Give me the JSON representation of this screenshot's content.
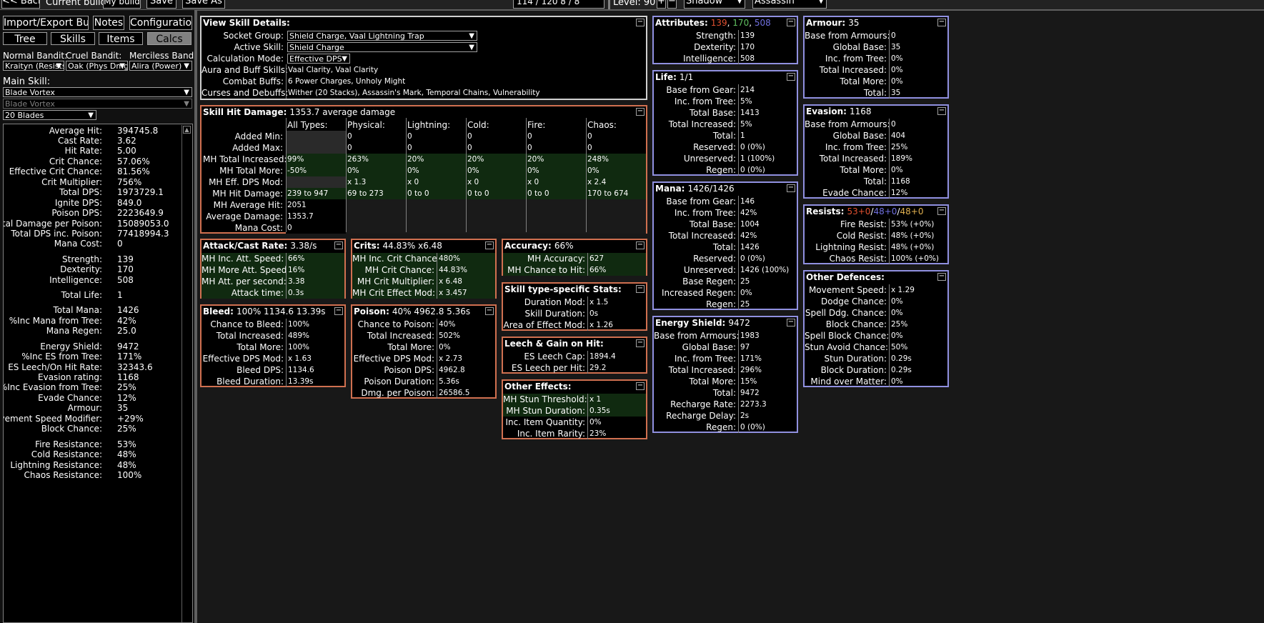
{
  "topbar": {
    "back": "<< Back",
    "current_build_label": "Current build:",
    "build_name": "My build",
    "save": "Save",
    "save_as": "Save As",
    "points": "114 / 120    8 / 8",
    "level": "Level: 90",
    "plus": "+",
    "minus": "−",
    "class": "Shadow",
    "ascendancy": "Assassin"
  },
  "sidebar": {
    "import_export": "Import/Export Build",
    "notes": "Notes",
    "configuration": "Configuration",
    "tabs": [
      "Tree",
      "Skills",
      "Items",
      "Calcs"
    ],
    "normal_bandit_label": "Normal Bandit:",
    "cruel_bandit_label": "Cruel Bandit:",
    "merciless_bandit_label": "Merciless Bandit:",
    "normal_bandit": "Kraityn (Resists)",
    "cruel_bandit": "Oak (Phys Dmg)",
    "merciless_bandit": "Alira (Power)",
    "main_skill_label": "Main Skill:",
    "main_skill": "Blade Vortex",
    "sub_skill": "Blade Vortex",
    "stage": "20 Blades",
    "stats": [
      {
        "k": "Average Hit:",
        "v": "394745.8"
      },
      {
        "k": "Cast Rate:",
        "v": "3.62"
      },
      {
        "k": "Hit Rate:",
        "v": "5.00"
      },
      {
        "k": "Crit Chance:",
        "v": "57.06%"
      },
      {
        "k": "Effective Crit Chance:",
        "v": "81.56%"
      },
      {
        "k": "Crit Multiplier:",
        "v": "756%"
      },
      {
        "k": "Total DPS:",
        "v": "1973729.1"
      },
      {
        "k": "Ignite DPS:",
        "v": "849.0"
      },
      {
        "k": "Poison DPS:",
        "v": "2223649.9"
      },
      {
        "k": "Total Damage per Poison:",
        "v": "15089053.0"
      },
      {
        "k": "Total DPS inc. Poison:",
        "v": "77418994.3"
      },
      {
        "k": "Mana Cost:",
        "v": "0"
      },
      {
        "k": "Strength:",
        "v": "139"
      },
      {
        "k": "Dexterity:",
        "v": "170"
      },
      {
        "k": "Intelligence:",
        "v": "508"
      },
      {
        "k": "Total Life:",
        "v": "1"
      },
      {
        "k": "Total Mana:",
        "v": "1426"
      },
      {
        "k": "%Inc Mana from Tree:",
        "v": "42%"
      },
      {
        "k": "Mana Regen:",
        "v": "25.0"
      },
      {
        "k": "Energy Shield:",
        "v": "9472"
      },
      {
        "k": "%Inc ES from Tree:",
        "v": "171%"
      },
      {
        "k": "ES Leech/On Hit Rate:",
        "v": "32343.6"
      },
      {
        "k": "Evasion rating:",
        "v": "1168"
      },
      {
        "k": "%Inc Evasion from Tree:",
        "v": "25%"
      },
      {
        "k": "Evade Chance:",
        "v": "12%"
      },
      {
        "k": "Armour:",
        "v": "35"
      },
      {
        "k": "Movement Speed Modifier:",
        "v": "+29%"
      },
      {
        "k": "Block Chance:",
        "v": "25%"
      },
      {
        "k": "Fire Resistance:",
        "v": "53%"
      },
      {
        "k": "Cold Resistance:",
        "v": "48%"
      },
      {
        "k": "Lightning Resistance:",
        "v": "48%"
      },
      {
        "k": "Chaos Resistance:",
        "v": "100%"
      }
    ]
  },
  "view_skill": {
    "title": "View Skill Details:",
    "socket_group_label": "Socket Group:",
    "socket_group": "Shield Charge, Vaal Lightning Trap",
    "active_skill_label": "Active Skill:",
    "active_skill": "Shield Charge",
    "calc_mode_label": "Calculation Mode:",
    "calc_mode": "Effective DPS",
    "aura_label": "Aura and Buff Skills:",
    "aura": "Vaal Clarity, Vaal Clarity",
    "combat_label": "Combat Buffs:",
    "combat": "6 Power Charges, Unholy Might",
    "curses_label": "Curses and Debuffs:",
    "curses": "Wither (20 Stacks), Assassin's Mark, Temporal Chains, Vulnerability"
  },
  "hit_damage": {
    "title": "Skill Hit Damage:",
    "value": "1353.7 average damage",
    "columns": [
      "All Types:",
      "Physical:",
      "Lightning:",
      "Cold:",
      "Fire:",
      "Chaos:"
    ],
    "rows": [
      {
        "k": "Added Min:",
        "cells": [
          "",
          "0",
          "0",
          "0",
          "0",
          "0"
        ]
      },
      {
        "k": "Added Max:",
        "cells": [
          "",
          "0",
          "0",
          "0",
          "0",
          "0"
        ]
      },
      {
        "k": "MH Total Increased:",
        "cells": [
          "99%",
          "263%",
          "20%",
          "20%",
          "20%",
          "248%"
        ]
      },
      {
        "k": "MH Total More:",
        "cells": [
          "-50%",
          "0%",
          "0%",
          "0%",
          "0%",
          "0%"
        ]
      },
      {
        "k": "MH Eff. DPS Mod:",
        "cells": [
          "",
          "x 1.3",
          "x 0",
          "x 0",
          "x 0",
          "x 2.4"
        ]
      },
      {
        "k": "MH Hit Damage:",
        "cells": [
          "239 to 947",
          "69 to 273",
          "0 to 0",
          "0 to 0",
          "0 to 0",
          "170 to 674"
        ]
      },
      {
        "k": "MH Average Hit:",
        "cells": [
          "2051"
        ]
      },
      {
        "k": "Average Damage:",
        "cells": [
          "1353.7"
        ]
      },
      {
        "k": "Mana Cost:",
        "cells": [
          "0"
        ]
      }
    ]
  },
  "attack_rate": {
    "title": "Attack/Cast Rate:",
    "value": "3.38/s",
    "rows": [
      {
        "k": "MH Inc. Att. Speed:",
        "v": "66%"
      },
      {
        "k": "MH More Att. Speed:",
        "v": "16%"
      },
      {
        "k": "MH Att. per second:",
        "v": "3.38"
      },
      {
        "k": "Attack time:",
        "v": "0.3s"
      }
    ]
  },
  "crits": {
    "title": "Crits:",
    "value": "44.83% x6.48",
    "rows": [
      {
        "k": "MH Inc. Crit Chance:",
        "v": "480%"
      },
      {
        "k": "MH Crit Chance:",
        "v": "44.83%"
      },
      {
        "k": "MH Crit Multiplier:",
        "v": "x 6.48"
      },
      {
        "k": "MH Crit Effect Mod:",
        "v": "x 3.457"
      }
    ]
  },
  "accuracy": {
    "title": "Accuracy:",
    "value": "66%",
    "rows": [
      {
        "k": "MH Accuracy:",
        "v": "627"
      },
      {
        "k": "MH Chance to Hit:",
        "v": "66%"
      }
    ]
  },
  "skill_type": {
    "title": "Skill type-specific Stats:",
    "rows": [
      {
        "k": "Duration Mod:",
        "v": "x 1.5"
      },
      {
        "k": "Skill Duration:",
        "v": "0s"
      },
      {
        "k": "Area of Effect Mod:",
        "v": "x 1.26"
      }
    ]
  },
  "leech": {
    "title": "Leech & Gain on Hit:",
    "rows": [
      {
        "k": "ES Leech Cap:",
        "v": "1894.4"
      },
      {
        "k": "ES Leech per Hit:",
        "v": "29.2"
      }
    ]
  },
  "other_effects": {
    "title": "Other Effects:",
    "rows": [
      {
        "k": "MH Stun Threshold:",
        "v": "x 1"
      },
      {
        "k": "MH Stun Duration:",
        "v": "0.35s"
      },
      {
        "k": "Inc. Item Quantity:",
        "v": "0%"
      },
      {
        "k": "Inc. Item Rarity:",
        "v": "23%"
      }
    ]
  },
  "bleed": {
    "title": "Bleed:",
    "value": "100% 1134.6 13.39s",
    "rows": [
      {
        "k": "Chance to Bleed:",
        "v": "100%"
      },
      {
        "k": "Total Increased:",
        "v": "489%"
      },
      {
        "k": "Total More:",
        "v": "100%"
      },
      {
        "k": "Effective DPS Mod:",
        "v": "x 1.63"
      },
      {
        "k": "Bleed DPS:",
        "v": "1134.6"
      },
      {
        "k": "Bleed Duration:",
        "v": "13.39s"
      }
    ]
  },
  "poison": {
    "title": "Poison:",
    "value": "40% 4962.8 5.36s",
    "rows": [
      {
        "k": "Chance to Poison:",
        "v": "40%"
      },
      {
        "k": "Total Increased:",
        "v": "502%"
      },
      {
        "k": "Total More:",
        "v": "0%"
      },
      {
        "k": "Effective DPS Mod:",
        "v": "x 2.73"
      },
      {
        "k": "Poison DPS:",
        "v": "4962.8"
      },
      {
        "k": "Poison Duration:",
        "v": "5.36s"
      },
      {
        "k": "Dmg. per Poison:",
        "v": "26586.5"
      }
    ]
  },
  "attributes": {
    "title": "Attributes:",
    "str": "139",
    "sep1": ", ",
    "dex": "170",
    "sep2": ", ",
    "int": "508",
    "rows": [
      {
        "k": "Strength:",
        "v": "139"
      },
      {
        "k": "Dexterity:",
        "v": "170"
      },
      {
        "k": "Intelligence:",
        "v": "508"
      }
    ]
  },
  "life": {
    "title": "Life:",
    "value": "1/1",
    "rows": [
      {
        "k": "Base from Gear:",
        "v": "214"
      },
      {
        "k": "Inc. from Tree:",
        "v": "5%"
      },
      {
        "k": "Total Base:",
        "v": "1413"
      },
      {
        "k": "Total Increased:",
        "v": "5%"
      },
      {
        "k": "Total:",
        "v": "1"
      },
      {
        "k": "Reserved:",
        "v": "0 (0%)"
      },
      {
        "k": "Unreserved:",
        "v": "1 (100%)"
      },
      {
        "k": "Regen:",
        "v": "0 (0%)"
      }
    ]
  },
  "mana": {
    "title": "Mana:",
    "value": "1426/1426",
    "rows": [
      {
        "k": "Base from Gear:",
        "v": "146"
      },
      {
        "k": "Inc. from Tree:",
        "v": "42%"
      },
      {
        "k": "Total Base:",
        "v": "1004"
      },
      {
        "k": "Total Increased:",
        "v": "42%"
      },
      {
        "k": "Total:",
        "v": "1426"
      },
      {
        "k": "Reserved:",
        "v": "0 (0%)"
      },
      {
        "k": "Unreserved:",
        "v": "1426 (100%)"
      },
      {
        "k": "Base Regen:",
        "v": "25"
      },
      {
        "k": "Increased Regen:",
        "v": "0%"
      },
      {
        "k": "Regen:",
        "v": "25"
      }
    ]
  },
  "energy_shield": {
    "title": "Energy Shield:",
    "value": "9472",
    "rows": [
      {
        "k": "Base from Armours:",
        "v": "1983"
      },
      {
        "k": "Global Base:",
        "v": "97"
      },
      {
        "k": "Inc. from Tree:",
        "v": "171%"
      },
      {
        "k": "Total Increased:",
        "v": "296%"
      },
      {
        "k": "Total More:",
        "v": "15%"
      },
      {
        "k": "Total:",
        "v": "9472"
      },
      {
        "k": "Recharge Rate:",
        "v": "2273.3"
      },
      {
        "k": "Recharge Delay:",
        "v": "2s"
      },
      {
        "k": "Regen:",
        "v": "0 (0%)"
      }
    ]
  },
  "armour": {
    "title": "Armour:",
    "value": "35",
    "rows": [
      {
        "k": "Base from Armours:",
        "v": "0"
      },
      {
        "k": "Global Base:",
        "v": "35"
      },
      {
        "k": "Inc. from Tree:",
        "v": "0%"
      },
      {
        "k": "Total Increased:",
        "v": "0%"
      },
      {
        "k": "Total More:",
        "v": "0%"
      },
      {
        "k": "Total:",
        "v": "35"
      }
    ]
  },
  "evasion": {
    "title": "Evasion:",
    "value": "1168",
    "rows": [
      {
        "k": "Base from Armours:",
        "v": "0"
      },
      {
        "k": "Global Base:",
        "v": "404"
      },
      {
        "k": "Inc. from Tree:",
        "v": "25%"
      },
      {
        "k": "Total Increased:",
        "v": "189%"
      },
      {
        "k": "Total More:",
        "v": "0%"
      },
      {
        "k": "Total:",
        "v": "1168"
      },
      {
        "k": "Evade Chance:",
        "v": "12%"
      }
    ]
  },
  "resists": {
    "title": "Resists:",
    "fire": "53+0",
    "s1": "/",
    "cold": "48+0",
    "s2": "/",
    "light": "48+0",
    "rows": [
      {
        "k": "Fire Resist:",
        "v": "53% (+0%)"
      },
      {
        "k": "Cold Resist:",
        "v": "48% (+0%)"
      },
      {
        "k": "Lightning Resist:",
        "v": "48% (+0%)"
      },
      {
        "k": "Chaos Resist:",
        "v": "100% (+0%)"
      }
    ]
  },
  "other_defences": {
    "title": "Other Defences:",
    "rows": [
      {
        "k": "Movement Speed:",
        "v": "x 1.29"
      },
      {
        "k": "Dodge Chance:",
        "v": "0%"
      },
      {
        "k": "Spell Ddg. Chance:",
        "v": "0%"
      },
      {
        "k": "Block Chance:",
        "v": "25%"
      },
      {
        "k": "Spell Block Chance:",
        "v": "0%"
      },
      {
        "k": "Stun Avoid Chance:",
        "v": "50%"
      },
      {
        "k": "Stun Duration:",
        "v": "0.29s"
      },
      {
        "k": "Block Duration:",
        "v": "0.29s"
      },
      {
        "k": "Mind over Matter:",
        "v": "0%"
      }
    ]
  },
  "colors": {
    "orange": "#d07050",
    "blue": "#9090e0",
    "str": "#e05030",
    "dex": "#60c060",
    "int": "#7070e0",
    "gold": "#e0b050"
  }
}
